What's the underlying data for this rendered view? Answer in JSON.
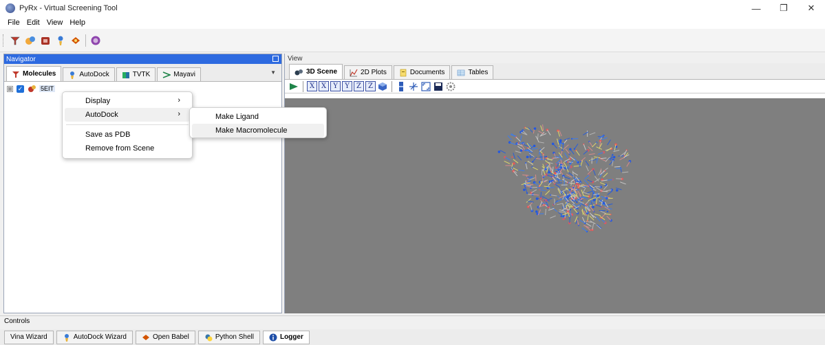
{
  "window": {
    "title": "PyRx - Virtual Screening Tool",
    "minimize": "—",
    "maximize": "❐",
    "close": "✕"
  },
  "menu": [
    "File",
    "Edit",
    "View",
    "Help"
  ],
  "navigator": {
    "title": "Navigator",
    "tabs": [
      "Molecules",
      "AutoDock",
      "TVTK",
      "Mayavi"
    ],
    "active_tab": "Molecules",
    "tree": {
      "expander": "⊞",
      "check": "✓",
      "label": "5EIT"
    }
  },
  "view": {
    "title": "View",
    "tabs": [
      "3D Scene",
      "2D Plots",
      "Documents",
      "Tables"
    ],
    "active_tab": "3D Scene",
    "axis_buttons": [
      "X",
      "X",
      "Y",
      "Y",
      "Z",
      "Z"
    ]
  },
  "context_menu": {
    "items": [
      "Display",
      "AutoDock",
      "Save as PDB",
      "Remove from Scene"
    ],
    "arrow": "›"
  },
  "submenu": {
    "items": [
      "Make Ligand",
      "Make Macromolecule"
    ]
  },
  "controls": {
    "title": "Controls",
    "tabs": [
      "Vina Wizard",
      "AutoDock Wizard",
      "Open Babel",
      "Python Shell",
      "Logger"
    ],
    "active_tab": "Logger"
  },
  "colors": {
    "nav_header": "#2d6ae0",
    "scene_bg": "#7f7f7f"
  }
}
